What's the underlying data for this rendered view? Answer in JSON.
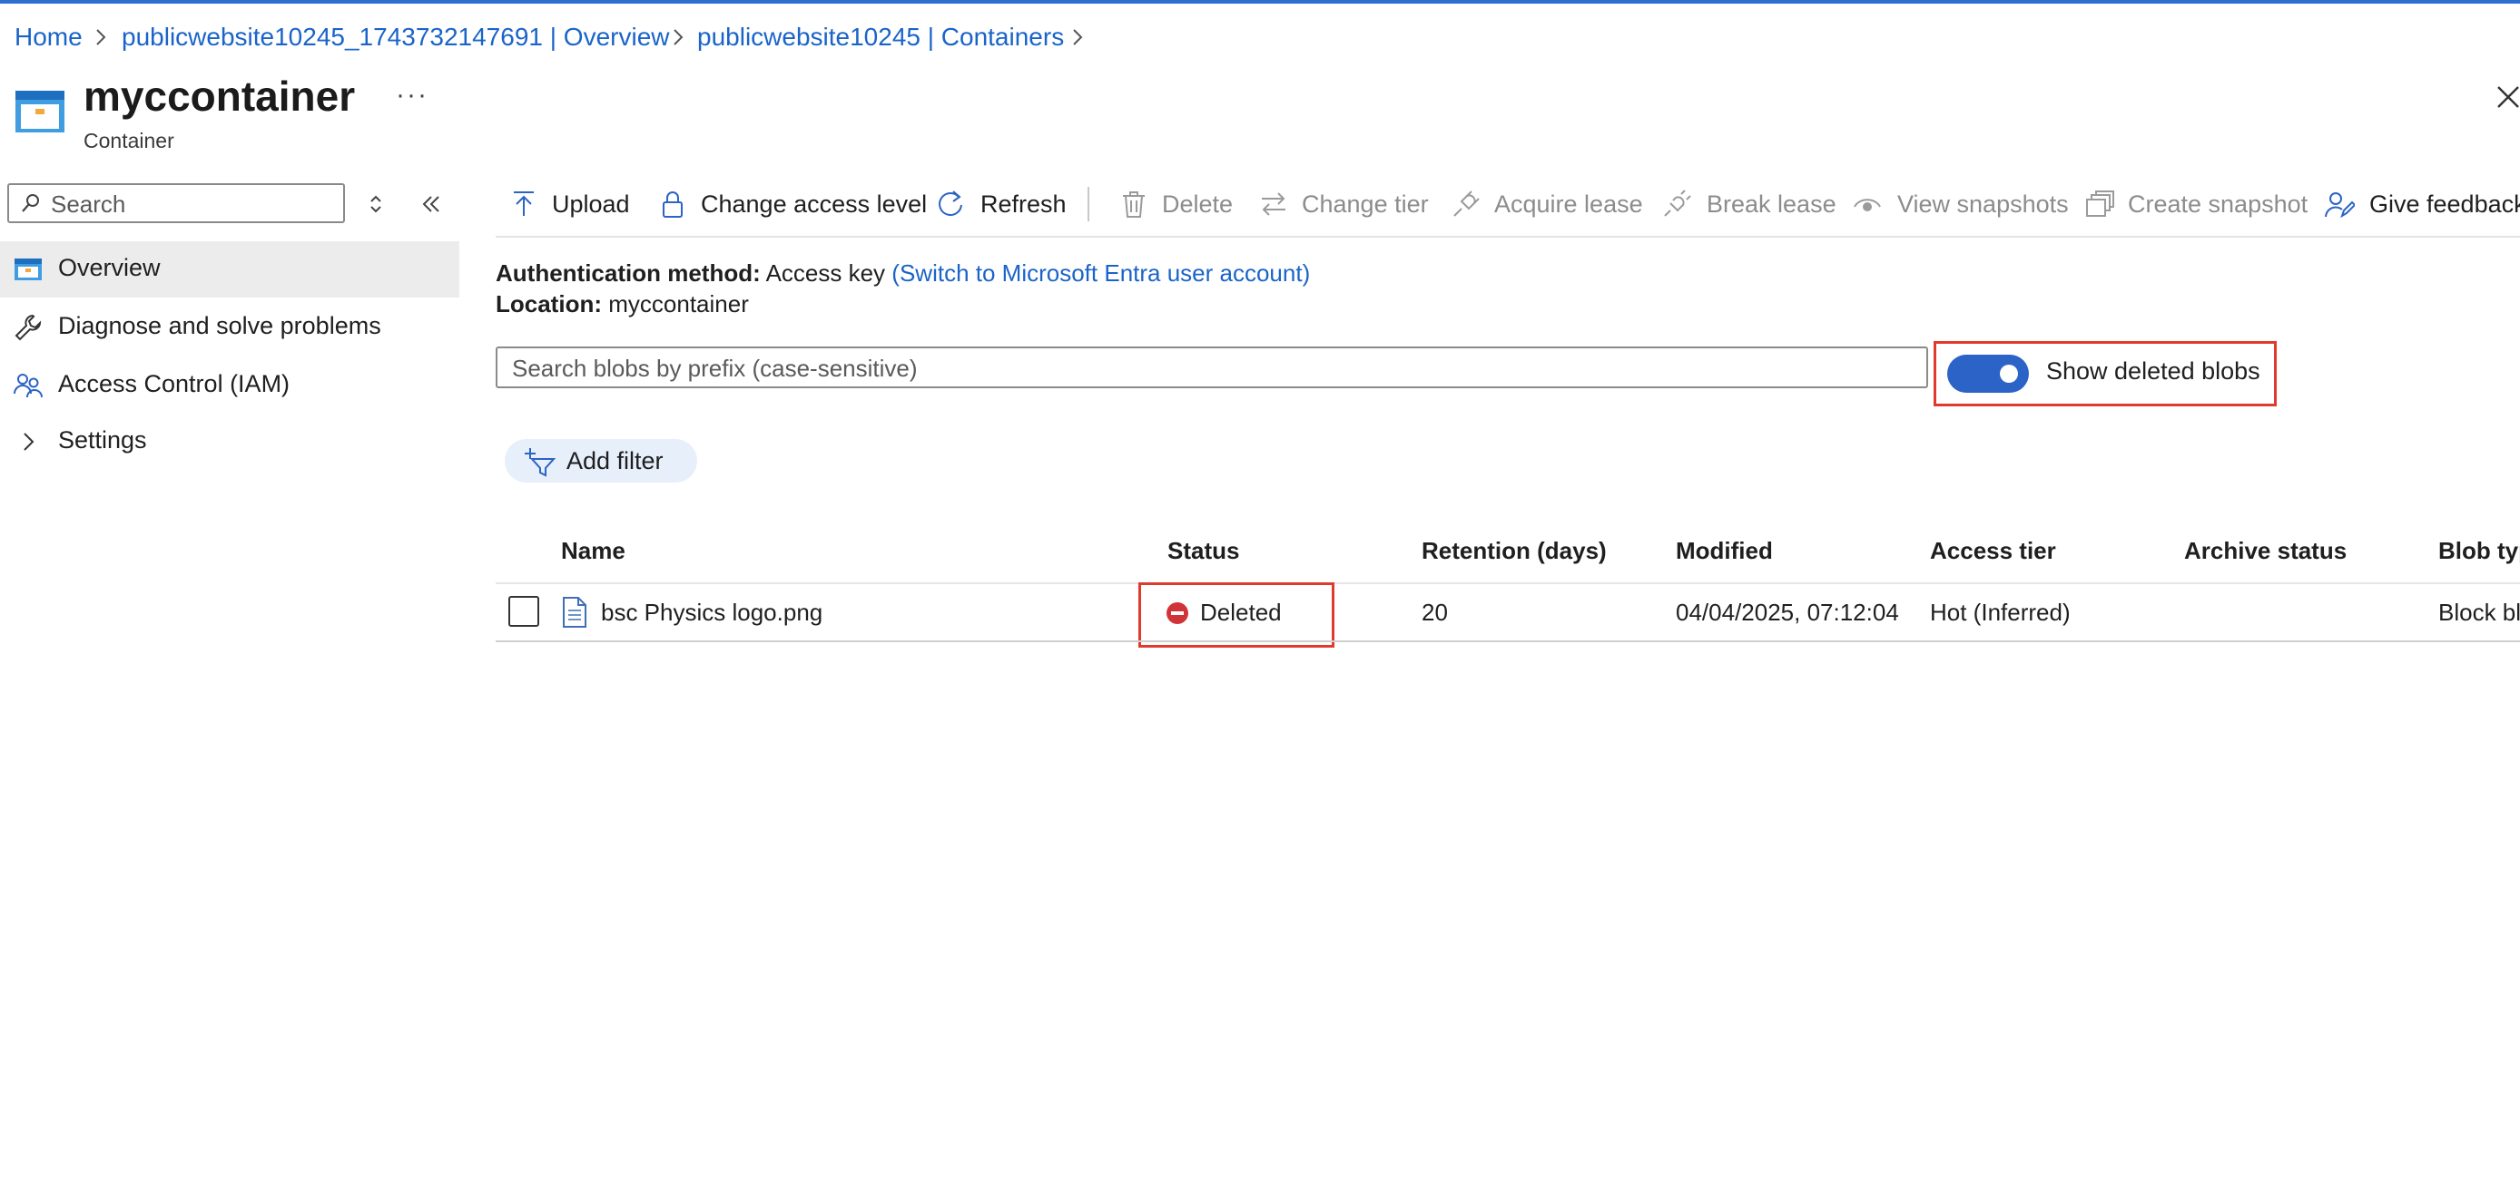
{
  "breadcrumb": {
    "items": [
      "Home",
      "publicwebsite10245_1743732147691 | Overview",
      "publicwebsite10245 | Containers"
    ]
  },
  "header": {
    "title": "myccontainer",
    "subtitle": "Container",
    "more": "···"
  },
  "sidebar": {
    "search_placeholder": "Search",
    "items": [
      {
        "label": "Overview",
        "icon": "container-icon",
        "selected": true
      },
      {
        "label": "Diagnose and solve problems",
        "icon": "wrench-icon"
      },
      {
        "label": "Access Control (IAM)",
        "icon": "people-icon"
      },
      {
        "label": "Settings",
        "icon": "chevron-right-icon"
      }
    ]
  },
  "toolbar": {
    "upload": "Upload",
    "change_access_level": "Change access level",
    "refresh": "Refresh",
    "delete": "Delete",
    "change_tier": "Change tier",
    "acquire_lease": "Acquire lease",
    "break_lease": "Break lease",
    "view_snapshots": "View snapshots",
    "create_snapshot": "Create snapshot",
    "give_feedback": "Give feedback"
  },
  "info": {
    "auth_label": "Authentication method:",
    "auth_value": "Access key",
    "auth_switch": "(Switch to Microsoft Entra user account)",
    "location_label": "Location:",
    "location_value": "myccontainer"
  },
  "blob_search": {
    "placeholder": "Search blobs by prefix (case-sensitive)"
  },
  "show_deleted": {
    "label": "Show deleted blobs",
    "enabled": true
  },
  "filter": {
    "add_filter": "Add filter"
  },
  "table": {
    "columns": {
      "name": "Name",
      "status": "Status",
      "retention": "Retention (days)",
      "modified": "Modified",
      "access_tier": "Access tier",
      "archive_status": "Archive status",
      "blob_type": "Blob typ"
    },
    "rows": [
      {
        "name": "bsc Physics logo.png",
        "status": "Deleted",
        "retention": "20",
        "modified": "04/04/2025, 07:12:04",
        "access_tier": "Hot (Inferred)",
        "archive_status": "",
        "blob_type": "Block bl"
      }
    ]
  },
  "colors": {
    "accent": "#2b63c6",
    "link": "#1a64c9",
    "highlight": "#e03a2e",
    "deleted": "#d13438"
  }
}
